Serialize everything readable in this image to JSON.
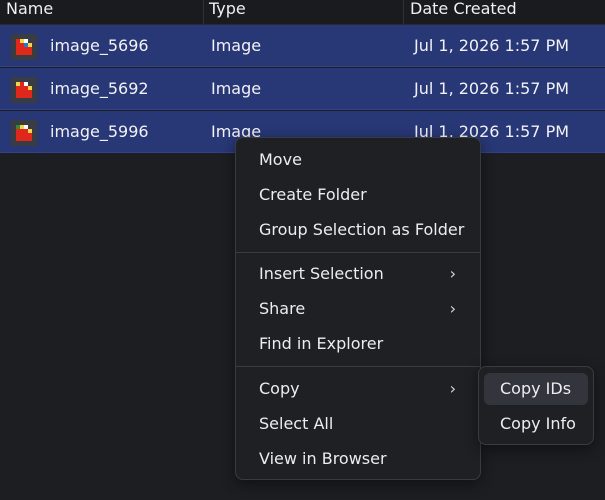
{
  "columns": {
    "name": "Name",
    "type": "Type",
    "date": "Date Created"
  },
  "rows": [
    {
      "name": "image_5696",
      "type": "Image",
      "date": "Jul 1, 2026 1:57 PM",
      "icon": "image-thumbnail-icon"
    },
    {
      "name": "image_5692",
      "type": "Image",
      "date": "Jul 1, 2026 1:57 PM",
      "icon": "image-thumbnail-icon"
    },
    {
      "name": "image_5996",
      "type": "Image",
      "date": "Jul 1, 2026 1:57 PM",
      "icon": "image-thumbnail-icon"
    }
  ],
  "context_menu": {
    "move": "Move",
    "create_folder": "Create Folder",
    "group_selection": "Group Selection as Folder",
    "insert_selection": "Insert Selection",
    "share": "Share",
    "find_in_explorer": "Find in Explorer",
    "copy": "Copy",
    "select_all": "Select All",
    "view_in_browser": "View in Browser",
    "chevron": "›"
  },
  "copy_submenu": {
    "copy_ids": "Copy IDs",
    "copy_info": "Copy Info"
  },
  "colors": {
    "background": "#1d1e22",
    "selected_row": "#283776",
    "menu_bg": "#1f2024",
    "menu_hover": "#33353c"
  }
}
